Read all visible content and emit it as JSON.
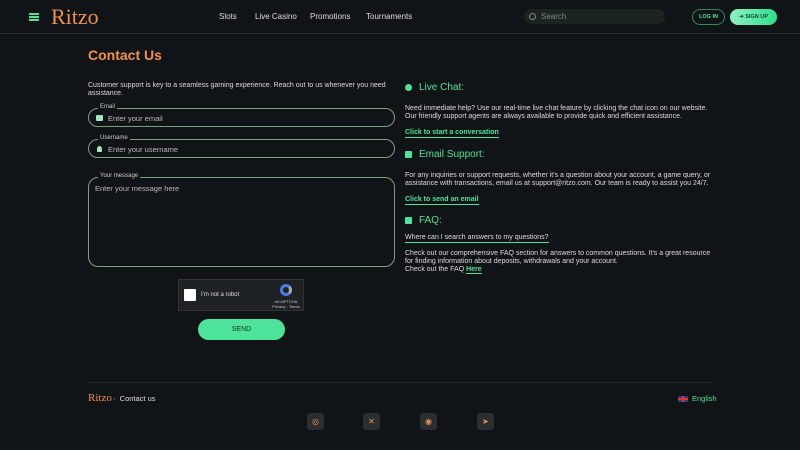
{
  "header": {
    "logo": "Ritzo",
    "nav": [
      "Slots",
      "Live Casino",
      "Promotions",
      "Tournaments"
    ],
    "search_placeholder": "Search",
    "login": "LOG IN",
    "signup": "SIGN UP"
  },
  "page": {
    "title": "Contact Us",
    "intro": "Customer support is key to a seamless gaming experience. Reach out to us whenever you need assistance."
  },
  "form": {
    "email_label": "Email",
    "email_placeholder": "Enter your email",
    "username_label": "Username",
    "username_placeholder": "Enter your username",
    "message_label": "Your message",
    "message_placeholder": "Enter your message here",
    "captcha_text": "I'm not a robot",
    "captcha_brand": "reCAPTCHA",
    "captcha_links": "Privacy - Terms",
    "send": "SEND"
  },
  "live_chat": {
    "title": "Live Chat:",
    "text": "Need immediate help? Use our real-time live chat feature by clicking the chat icon on our website. Our friendly support agents are always available to provide quick and efficient assistance.",
    "link": "Click to start a conversation"
  },
  "email_support": {
    "title": "Email Support:",
    "text": "For any inquiries or support requests, whether it's a question about your account, a game query, or assistance with transactions, email us at support@ritzo.com. Our team is ready to assist you 24/7.",
    "link": "Click to send an email"
  },
  "faq": {
    "title": "FAQ:",
    "question": "Where can I search answers to my questions?",
    "text": "Check out our comprehensive FAQ section for answers to common questions. It's a great resource for finding information about deposits, withdrawals and your account.",
    "text2": "Check out the FAQ",
    "link": "Here"
  },
  "footer": {
    "logo": "Ritzo",
    "breadcrumb": "Contact us",
    "language": "English",
    "social": [
      "instagram-icon",
      "x-icon",
      "discord-icon",
      "telegram-icon"
    ]
  },
  "colors": {
    "accent": "#4ee39a",
    "brand": "#f0924a",
    "background": "#111416"
  }
}
